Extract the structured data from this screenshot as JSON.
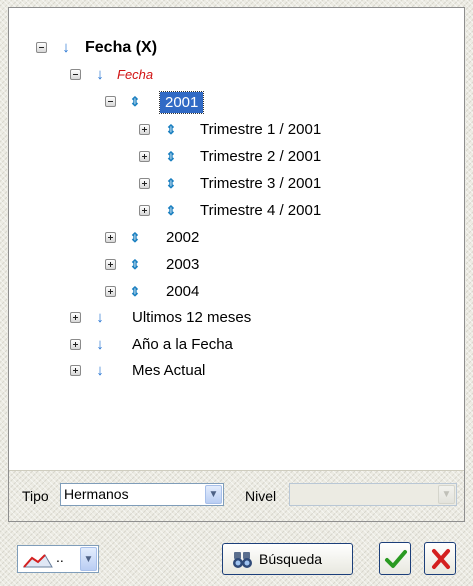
{
  "tree": {
    "root_label": "Fecha (X)",
    "group_label": "Fecha",
    "selected_year": "2001",
    "quarters": [
      "Trimestre 1 / 2001",
      "Trimestre 2 / 2001",
      "Trimestre 3 / 2001",
      "Trimestre 4 / 2001"
    ],
    "years": [
      "2002",
      "2003",
      "2004"
    ],
    "special": [
      "Ultimos 12 meses",
      "Año a la Fecha",
      "Mes Actual"
    ]
  },
  "filters": {
    "tipo_label": "Tipo",
    "tipo_value": "Hermanos",
    "nivel_label": "Nivel",
    "nivel_value": ""
  },
  "toolbar": {
    "chart_dots": "..",
    "search_label": "Búsqueda"
  },
  "colors": {
    "selection": "#316ac5",
    "arrow": "#1f6fd1",
    "red_label": "#d11414",
    "ok_green": "#2a9a22",
    "cancel_red": "#d42020"
  },
  "icons": {
    "collapse": "minus-box-icon",
    "expand": "plus-box-icon",
    "arrow_down": "arrow-down-icon",
    "arrow_updown": "arrow-updown-icon",
    "ok": "check-icon",
    "cancel": "x-icon",
    "search": "binoculars-icon",
    "chart": "chart-icon"
  }
}
